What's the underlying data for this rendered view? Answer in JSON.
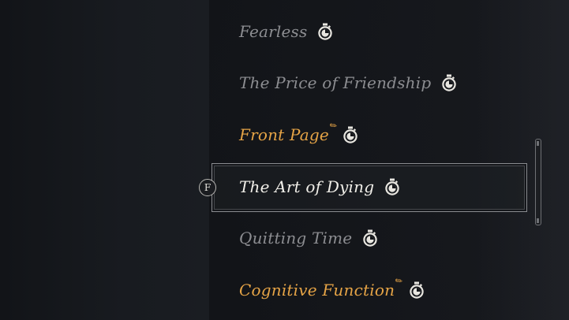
{
  "quest_log": {
    "items": [
      {
        "title": "Fearless",
        "state": "dim",
        "new": false,
        "icon": "stopwatch-icon"
      },
      {
        "title": "The Price of Friendship",
        "state": "dim",
        "new": false,
        "icon": "stopwatch-icon"
      },
      {
        "title": "Front Page",
        "state": "new",
        "new": true,
        "icon": "stopwatch-icon"
      },
      {
        "title": "The Art of Dying",
        "state": "selected",
        "new": false,
        "icon": "stopwatch-icon"
      },
      {
        "title": "Quitting Time",
        "state": "dim",
        "new": false,
        "icon": "stopwatch-icon"
      },
      {
        "title": "Cognitive Function",
        "state": "new",
        "new": true,
        "icon": "stopwatch-icon"
      }
    ],
    "selected_key_hint": "F",
    "new_marker_glyph": "✎"
  },
  "colors": {
    "dim_text": "#8c8d91",
    "new_text": "#e6a446",
    "selected_text": "#f1efe9",
    "frame": "#8a8c90"
  }
}
